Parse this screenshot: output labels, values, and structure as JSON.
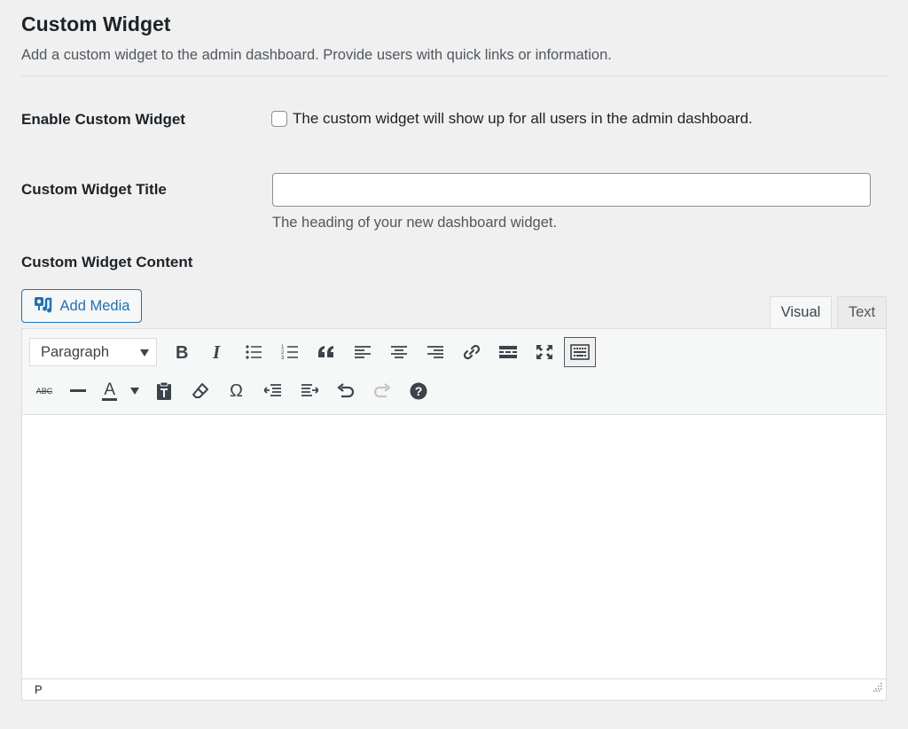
{
  "section": {
    "title": "Custom Widget",
    "description": "Add a custom widget to the admin dashboard. Provide users with quick links or information."
  },
  "fields": {
    "enable": {
      "label": "Enable Custom Widget",
      "checkbox_text": "The custom widget will show up for all users in the admin dashboard.",
      "checked": false
    },
    "title": {
      "label": "Custom Widget Title",
      "value": "",
      "description": "The heading of your new dashboard widget."
    },
    "content": {
      "label": "Custom Widget Content"
    }
  },
  "editor": {
    "add_media_label": "Add Media",
    "tabs": [
      "Visual",
      "Text"
    ],
    "active_tab": "Visual",
    "format_select": "Paragraph",
    "toolbar_row1": [
      "bold-icon",
      "italic-icon",
      "bulleted-list-icon",
      "numbered-list-icon",
      "blockquote-icon",
      "align-left-icon",
      "align-center-icon",
      "align-right-icon",
      "link-icon",
      "read-more-icon",
      "fullscreen-icon",
      "toolbar-toggle-icon"
    ],
    "toolbar_row2": [
      "strikethrough-icon",
      "horizontal-line-icon",
      "text-color-icon",
      "paste-as-text-icon",
      "clear-formatting-icon",
      "special-character-icon",
      "outdent-icon",
      "indent-icon",
      "undo-icon",
      "redo-icon",
      "help-icon"
    ],
    "text_color_glyph": "A",
    "strikethrough_glyph": "ABC",
    "omega_glyph": "Ω",
    "status_path": "P"
  },
  "colors": {
    "accent": "#2271b1",
    "background": "#f0f0f1",
    "text": "#1d2327"
  }
}
